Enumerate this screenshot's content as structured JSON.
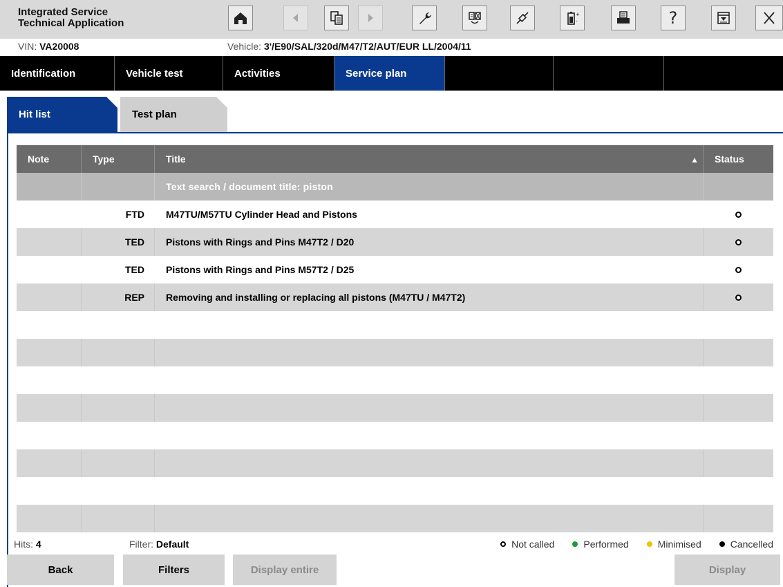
{
  "app": {
    "title_line1": "Integrated Service",
    "title_line2": "Technical Application"
  },
  "toolbar": {
    "icons": [
      "home-icon",
      "back-arrow-icon",
      "documents-icon",
      "forward-arrow-icon",
      "wrench-icon",
      "diagnosis-icon",
      "connection-icon",
      "battery-icon",
      "print-icon",
      "help-icon",
      "minimise-icon",
      "close-icon"
    ],
    "help_label": "?"
  },
  "vehicle_info": {
    "vin_label": "VIN:",
    "vin_value": "VA20008",
    "vehicle_label": "Vehicle:",
    "vehicle_value": "3'/E90/SAL/320d/M47/T2/AUT/EUR LL/2004/11"
  },
  "main_nav": {
    "tabs": [
      {
        "label": "Identification"
      },
      {
        "label": "Vehicle test"
      },
      {
        "label": "Activities"
      },
      {
        "label": "Service plan",
        "active": true
      },
      {
        "label": ""
      },
      {
        "label": ""
      },
      {
        "label": ""
      }
    ]
  },
  "sub_tabs": {
    "hit_list": "Hit list",
    "test_plan": "Test plan"
  },
  "table": {
    "columns": {
      "note": "Note",
      "type": "Type",
      "title": "Title",
      "status": "Status"
    },
    "sort_indicator": "▲",
    "search_row": "Text search / document title: piston",
    "rows": [
      {
        "note": "",
        "type": "FTD",
        "title": "M47TU/M57TU Cylinder Head and Pistons",
        "status": "Not called"
      },
      {
        "note": "",
        "type": "TED",
        "title": "Pistons with Rings and Pins M47T2 / D20",
        "status": "Not called"
      },
      {
        "note": "",
        "type": "TED",
        "title": "Pistons with Rings and Pins M57T2 / D25",
        "status": "Not called"
      },
      {
        "note": "",
        "type": "REP",
        "title": "Removing and installing or replacing all pistons (M47TU / M47T2)",
        "status": "Not called"
      }
    ]
  },
  "footer": {
    "hits_label": "Hits:",
    "hits_value": "4",
    "filter_label": "Filter:",
    "filter_value": "Default",
    "legend": [
      {
        "label": "Not called",
        "color": "#ffffff"
      },
      {
        "label": "Performed",
        "color": "#1a9a3a"
      },
      {
        "label": "Minimised",
        "color": "#f2c200"
      },
      {
        "label": "Cancelled",
        "color": "#000000"
      }
    ]
  },
  "buttons": {
    "back": "Back",
    "filters": "Filters",
    "display_entire": "Display entire",
    "display": "Display"
  },
  "colors": {
    "accent": "#0a3a8f",
    "header_grey": "#6b6b6b"
  }
}
